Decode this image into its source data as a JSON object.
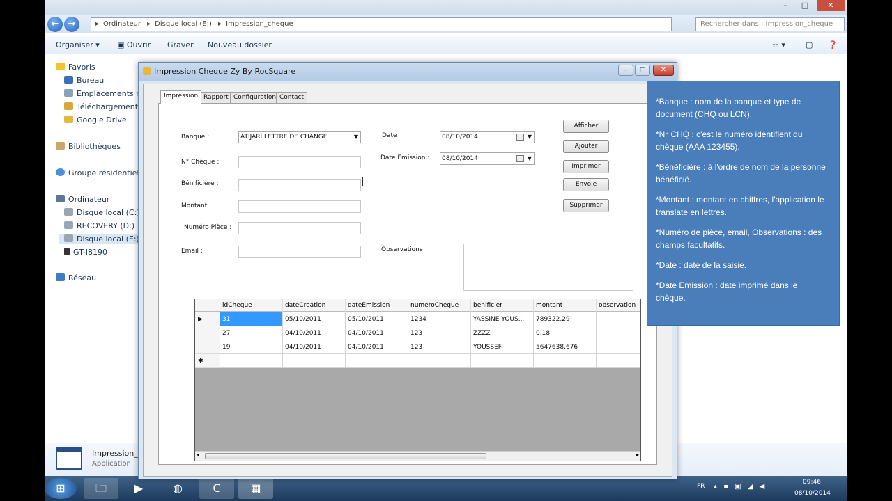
{
  "explorer": {
    "address_parts": [
      "Ordinateur",
      "Disque local (E:)",
      "Impression_cheque"
    ],
    "search_placeholder": "Rechercher dans : Impression_cheque",
    "toolbar": {
      "organize": "Organiser ▾",
      "open": "Ouvrir",
      "burn": "Graver",
      "new_folder": "Nouveau dossier"
    },
    "sidebar": {
      "favorites": "Favoris",
      "desktop": "Bureau",
      "recent_places": "Emplacements réc",
      "downloads": "Téléchargements",
      "google_drive": "Google Drive",
      "libraries": "Bibliothèques",
      "homegroup": "Groupe résidentiel",
      "computer": "Ordinateur",
      "drive_c": "Disque local (C:)",
      "drive_d": "RECOVERY (D:)",
      "drive_e": "Disque local (E:)",
      "device": "GT-I8190",
      "network": "Réseau"
    },
    "details": {
      "name": "Impression_(",
      "type": "Application"
    }
  },
  "app": {
    "title": "Impression Cheque Zy  By RocSquare",
    "tabs": [
      "Impression",
      "Rapport",
      "Configuration",
      "Contact"
    ],
    "form": {
      "bank_label": "Banque :",
      "bank_value": "ATIJARI LETTRE DE CHANGE",
      "cheque_no_label": "N° Chèque :",
      "beneficiary_label": "Bénificière :",
      "amount_label": "Montant :",
      "piece_label": "Numéro Pièce :",
      "email_label": "Email :",
      "date_label": "Date",
      "date_value": "08/10/2014",
      "emission_label": "Date Emission :",
      "emission_value": "08/10/2014",
      "observations_label": "Observations"
    },
    "buttons": {
      "show": "Afficher",
      "add": "Ajouter",
      "print": "Imprimer",
      "send": "Envoie",
      "delete": "Supprimer"
    },
    "grid": {
      "columns": [
        "idCheque",
        "dateCreation",
        "dateEmission",
        "numeroCheque",
        "benificier",
        "montant",
        "observation"
      ],
      "rows": [
        [
          "31",
          "05/10/2011",
          "05/10/2011",
          "1234",
          "YASSINE YOUS...",
          "789322,29",
          ""
        ],
        [
          "27",
          "04/10/2011",
          "04/10/2011",
          "123",
          "ZZZZ",
          "0,18",
          ""
        ],
        [
          "19",
          "04/10/2011",
          "04/10/2011",
          "123",
          "YOUSSEF",
          "5647638,676",
          ""
        ]
      ],
      "current_row_marker": "▶",
      "new_row_marker": "✱"
    }
  },
  "help_notes": [
    "*Banque : nom de la banque et type de document (CHQ ou LCN).",
    "*N° CHQ : c'est le numéro identifient du chèque (AAA 123455).",
    "*Bénéficière : à l'ordre de nom de la personne bénéficié.",
    "*Montant : montant en chiffres, l'application le translate en lettres.",
    "*Numéro de pièce, email, Observations : des champs facultatifs.",
    "*Date : date de la saisie.",
    "*Date Emission : date imprimé dans le chèque."
  ],
  "tray": {
    "lang": "FR",
    "time": "09:46",
    "date": "08/10/2014"
  }
}
